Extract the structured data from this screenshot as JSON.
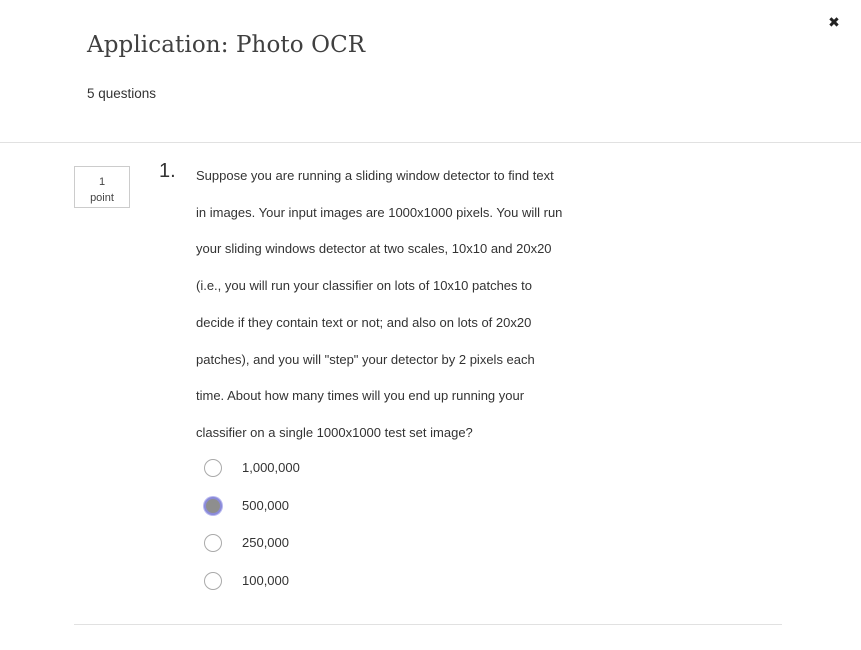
{
  "header": {
    "close_icon": "✖",
    "title": "Application: Photo OCR",
    "subtitle": "5 questions"
  },
  "question": {
    "points_value": "1",
    "points_label": "point",
    "number": "1.",
    "text": "Suppose you are running a sliding window detector to find text in images. Your input images are 1000x1000 pixels. You will run your sliding windows detector at two scales, 10x10 and 20x20 (i.e., you will run your classifier on lots of 10x10 patches to decide if they contain text or not; and also on lots of 20x20 patches), and you will \"step\" your detector by 2 pixels each time. About how many times will you end up running your classifier on a single 1000x1000 test set image?",
    "options": [
      {
        "label": "1,000,000",
        "selected": false
      },
      {
        "label": "500,000",
        "selected": true
      },
      {
        "label": "250,000",
        "selected": false
      },
      {
        "label": "100,000",
        "selected": false
      }
    ]
  },
  "colors": {
    "selected_ring": "#8a8ad8",
    "selected_fill": "#8e8e8e",
    "divider": "#e1e1e1"
  }
}
